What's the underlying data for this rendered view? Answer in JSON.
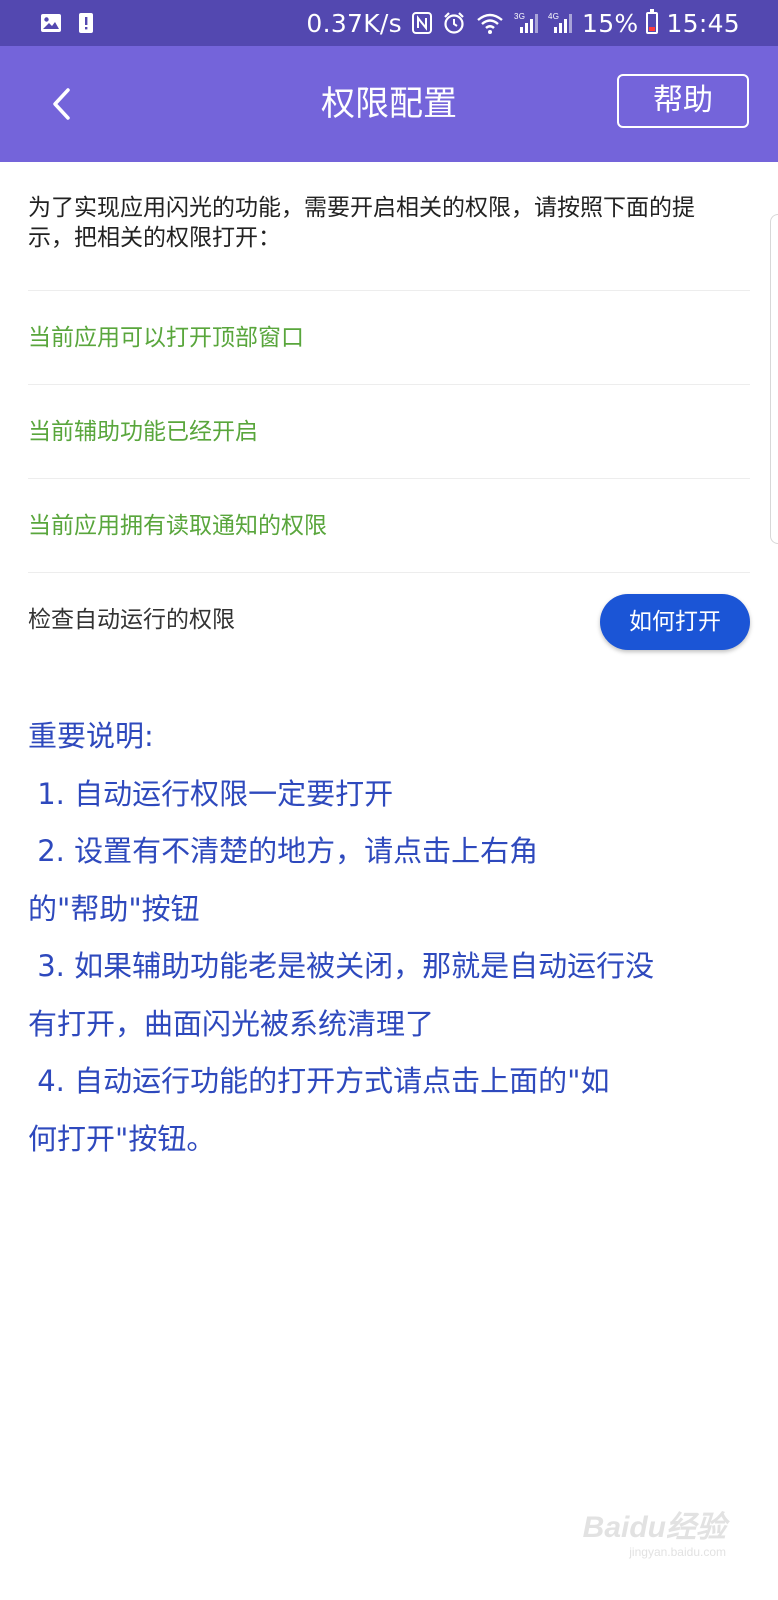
{
  "status_bar": {
    "network_speed": "0.37K/s",
    "battery_percent": "15%",
    "time": "15:45",
    "icons": [
      "image-icon",
      "alert-icon",
      "nfc-icon",
      "alarm-icon",
      "wifi-icon",
      "signal-3g-icon",
      "signal-4g-icon",
      "battery-icon"
    ],
    "battery_color": "#ff3b3b"
  },
  "header": {
    "back_icon": "chevron-left-icon",
    "title": "权限配置",
    "help_label": "帮助",
    "background": "#7464da"
  },
  "intro": {
    "text": "为了实现应用闪光的功能，需要开启相关的权限，请按照下面的提示，把相关的权限打开："
  },
  "permission_rows": [
    {
      "label": "当前应用可以打开顶部窗口",
      "status": "ok"
    },
    {
      "label": "当前辅助功能已经开启",
      "status": "ok"
    },
    {
      "label": "当前应用拥有读取通知的权限",
      "status": "ok"
    }
  ],
  "check_row": {
    "label": "检查自动运行的权限",
    "button_label": "如何打开"
  },
  "note": {
    "lines": [
      "重要说明:",
      " 1. 自动运行权限一定要打开",
      " 2. 设置有不清楚的地方，请点击上右角",
      "的\"帮助\"按钮",
      " 3. 如果辅助功能老是被关闭，那就是自动运行没",
      "有打开，曲面闪光被系统清理了",
      " 4. 自动运行功能的打开方式请点击上面的\"如",
      "何打开\"按钮。"
    ]
  },
  "watermark": {
    "text": "Baidu经验",
    "sub": "jingyan.baidu.com"
  }
}
